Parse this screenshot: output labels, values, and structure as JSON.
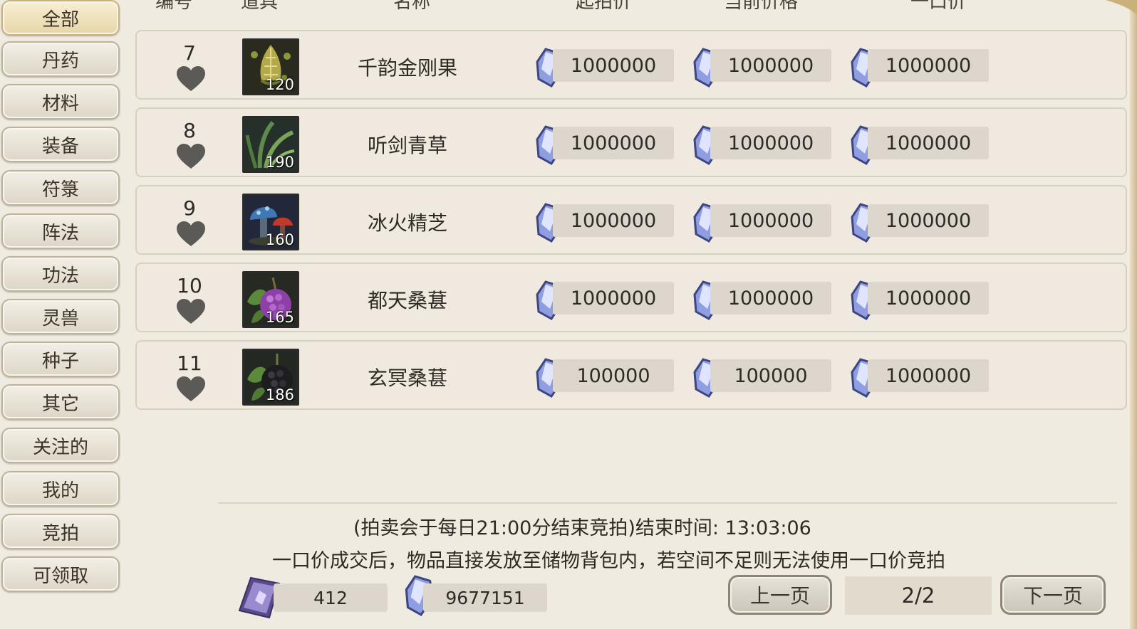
{
  "sidebar": {
    "items": [
      {
        "label": "全部",
        "active": true
      },
      {
        "label": "丹药"
      },
      {
        "label": "材料"
      },
      {
        "label": "装备"
      },
      {
        "label": "符箓"
      },
      {
        "label": "阵法"
      },
      {
        "label": "功法"
      },
      {
        "label": "灵兽"
      },
      {
        "label": "种子"
      },
      {
        "label": "其它"
      },
      {
        "label": "关注的"
      },
      {
        "label": "我的"
      },
      {
        "label": "竞拍"
      },
      {
        "label": "可领取"
      }
    ]
  },
  "table": {
    "headers": [
      "编号",
      "道具",
      "名称",
      "起拍价",
      "当前价格",
      "一口价"
    ],
    "rows": [
      {
        "num": "7",
        "level": "120",
        "name": "千韵金刚果",
        "start": "1000000",
        "current": "1000000",
        "buyout": "1000000",
        "icon": "golden-fruit-icon"
      },
      {
        "num": "8",
        "level": "190",
        "name": "听剑青草",
        "start": "1000000",
        "current": "1000000",
        "buyout": "1000000",
        "icon": "green-grass-icon"
      },
      {
        "num": "9",
        "level": "160",
        "name": "冰火精芝",
        "start": "1000000",
        "current": "1000000",
        "buyout": "1000000",
        "icon": "mushroom-icon"
      },
      {
        "num": "10",
        "level": "165",
        "name": "都天桑葚",
        "start": "1000000",
        "current": "1000000",
        "buyout": "1000000",
        "icon": "purple-berry-icon"
      },
      {
        "num": "11",
        "level": "186",
        "name": "玄冥桑葚",
        "start": "100000",
        "current": "100000",
        "buyout": "1000000",
        "icon": "black-berry-icon"
      }
    ]
  },
  "footer": {
    "notice1": "(拍卖会于每日21:00分结束竞拍)结束时间: 13:03:06",
    "notice2": "一口价成交后，物品直接发放至储物背包内，若空间不足则无法使用一口价竞拍",
    "ticket_count": "412",
    "stone_count": "9677151",
    "prev_label": "上一页",
    "page": "2/2",
    "next_label": "下一页"
  },
  "colors": {
    "crystal": "#8f9ee0",
    "heart": "#5c5a57",
    "button_border": "#8d8477"
  }
}
